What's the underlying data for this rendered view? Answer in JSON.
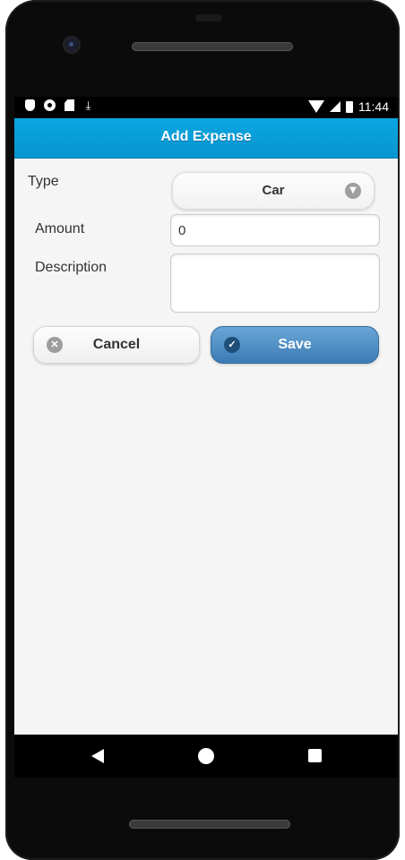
{
  "status_bar": {
    "time": "11:44",
    "left_icons": [
      "shield-icon",
      "circle-icon",
      "sd-card-icon",
      "download-icon"
    ],
    "right_icons": [
      "wifi-icon",
      "signal-icon",
      "battery-icon"
    ]
  },
  "header": {
    "title": "Add Expense",
    "color": "#0ba6e2"
  },
  "form": {
    "type_label": "Type",
    "type_value": "Car",
    "amount_label": "Amount",
    "amount_value": "0",
    "description_label": "Description",
    "description_value": ""
  },
  "actions": {
    "cancel_label": "Cancel",
    "save_label": "Save",
    "save_color": "#3b7bb5"
  },
  "navigation": {
    "icons": [
      "back-icon",
      "home-icon",
      "recent-apps-icon"
    ]
  }
}
